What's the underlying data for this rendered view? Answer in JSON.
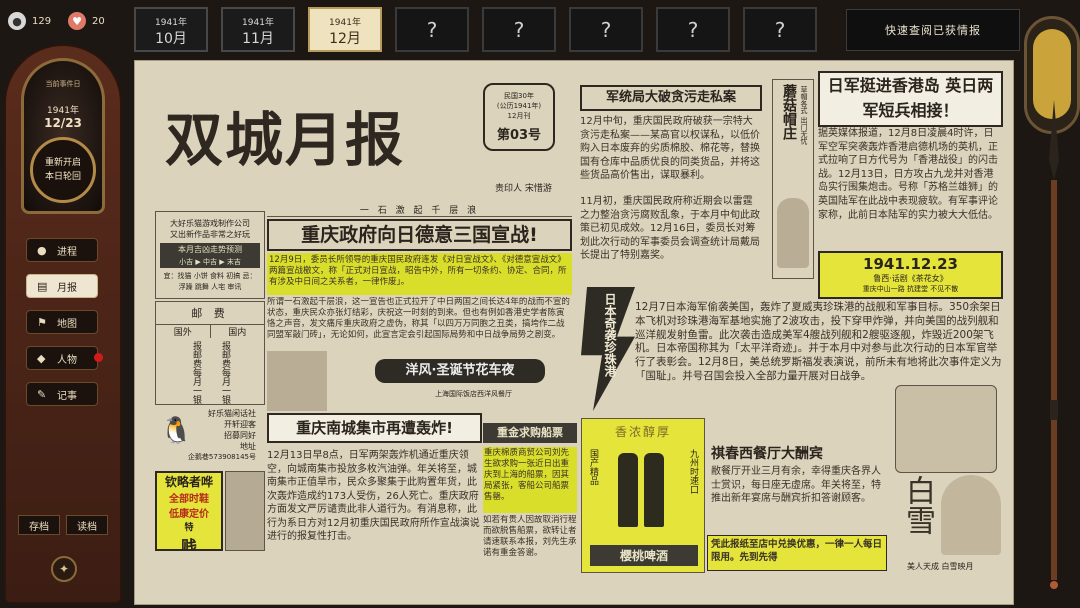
{
  "stats": {
    "coins": "129",
    "hearts": "20"
  },
  "clock": {
    "small": "当前事件日",
    "year": "1941年",
    "date": "12/23",
    "line1": "重新开启",
    "line2": "本日轮回"
  },
  "nav": [
    {
      "label": "进程",
      "icon": "●"
    },
    {
      "label": "月报",
      "icon": "▤"
    },
    {
      "label": "地图",
      "icon": "⚑"
    },
    {
      "label": "人物",
      "icon": "◆"
    },
    {
      "label": "记事",
      "icon": "✎"
    }
  ],
  "save": "存档",
  "load": "读档",
  "tabs": [
    {
      "y": "1941年",
      "m": "10月"
    },
    {
      "y": "1941年",
      "m": "11月"
    },
    {
      "y": "1941年",
      "m": "12月"
    }
  ],
  "locked_tab": "?",
  "quick": "快速查阅已获情报",
  "paper": {
    "masthead": "双城月报",
    "issue": {
      "l1": "民国30年",
      "l2": "(公历1941年)",
      "l3": "12月刊",
      "no": "第03号"
    },
    "printer": "责印人  宋惜游",
    "proverb": "一 石 激 起 千 层 浪",
    "h_war": "重庆政府向日德意三国宣战!",
    "war_hl": "12月9日，委员长所领导的重庆国民政府连发《对日宣战文》、《对德意宣战文》两篇宣战檄文，称「正式对日宣战，昭告中外，所有一切条约、协定、合同，所有涉及中日间之关系者，一律作废」。",
    "war_body": "所谓一石激起千层浪，这一宣告也正式拉开了中日两国之间长达4年的战而不宣的状态，重庆民众亦张灯结彩，庆祝这一时刻的到来。但也有例如香港史学者陈寅恪之声音，发文痛斥重庆政府之虚伪，称其「以四万万同胞之丑类，搞垮作二战同盟军敲门砖」，无论如何，此宣言定会引起国际局势和中日战争局势之剧变。",
    "h_bazaar": "洋风·圣诞节花车夜",
    "bazaar_sub": "上海国际饭店西洋风餐厅",
    "ad_left": {
      "l1": "大好乐猫游戏制作公司",
      "l2": "又出新作品非常之好玩",
      "bar1": "本月吉凶走势预测",
      "bar2": "小吉 ▶ 中吉 ▶ 末吉",
      "grid": "宜：找猫 小饼 食料 初搞  忌：浮躁 跳舞 人宅 审讯"
    },
    "postal": {
      "title": "邮 费",
      "c1": "国外",
      "c2": "国内",
      "rows": "报邮费每月一银元"
    },
    "cat_ad": {
      "l1": "好乐猫闲话社",
      "l2": "开轩迎客",
      "l3": "招募同好",
      "l4": "地址",
      "l5": "企鹅巷573908145号"
    },
    "h_bomb": "重庆南城集市再遭轰炸!",
    "bomb_body": "12月13日早8点，日军两架轰炸机通近重庆领空，向城南集市投放多枚汽油弹。年关将至，城南集市正值旱市，民众多聚集于此购置年货，此次轰炸造成约173人受伤，26人死亡。重庆政府方面发文严厉谴责此非人道行为。有消息称，此行为系日方对12月初重庆国民政府所作宣战演说进行的报复性打击。",
    "h_pest": "军统局大破贪污走私案",
    "pest_body": "12月中旬，重庆国民政府破获一宗特大贪污走私案——某高官以权谋私，以低价购入日本废弃的劣质棉胶、棉花等，替换国有仓库中品质优良的同类货品，并将这些货品高价售出，谋取暴利。",
    "pest_body2": "11月初，重庆国民政府称近期会以雷霆之力整治贪污腐败乱象，于本月中旬此政策已初见成效。12月16日，委员长对筹划此次行动的军事委员会调查统计局戴局长提出了特别嘉奖。",
    "hat": {
      "title": "蘑菇帽庄",
      "sub": "草帽各式 出门无忧"
    },
    "h_hk": "日军挺进香港岛 英日两军短兵相接！",
    "hk_body": "据英媒体报道，12月8日凌晨4时许，日军空军突袭轰炸香港启德机场的英机，正式拉响了日方代号为「香港战役」的闪击战。12月13日，日方攻占九龙并对香港岛实行围集炮击。号称「苏格兰雄狮」的英国陆军在此战中表现疲软。有军事评论家称，此前日本陆军的实力被大大低估。",
    "stamp": {
      "date": "1941.12.23",
      "l1": "鲁西·话剧《茶花女》",
      "l2": "重庆中山一路 抗建堂  不见不散"
    },
    "vertical": "日本奇袭珍珠港",
    "pearl_body": "12月7日本海军偷袭美国，轰炸了夏威夷珍珠港的战舰和军事目标。350余架日本飞机对珍珠港海军基地实施了2波攻击，投下穿甲炸弹，并向美国的战列舰和巡洋舰发射鱼雷。此次袭击造成美军4艘战列舰和2艘驱逐舰，炸毁近200架飞机。日本帝国称其为「太平洋奇迹」。并于本月中对参与此次行动的日本军官举行了表彰会。12月8日，美总统罗斯福发表演说，前所未有地将此次事件定义为「国耻」。并号召国会投入全部力量开展对日战争。",
    "ad_red": {
      "l1": "钦略者哗",
      "l2": "全部时鞋",
      "l3": "低康定价",
      "tag": "特",
      "price": "贱"
    },
    "h_gold": "重金求购船票",
    "gold_hl": "重庆棉质商贸公司刘先生欲求购一张近日出重庆到上海的船票，因其局紧张，客船公司船票售罄。",
    "gold_body": "如若有贵人因故取消行程而欲脱售船票，欲转让者请速联系本报，刘先生承诺有重金答谢。",
    "beer": {
      "l1": "香浓醇厚",
      "l2": "樱桃啤酒",
      "side1": "国产精品",
      "side2": "九州时速口"
    },
    "h_rest": "祺春西餐厅大酬宾",
    "rest_body": "敝餐厅开业三月有余，幸得重庆各界人士赏识，每日座无虚席。年关将至，特推出新年宴席与酬宾折扣答谢顾客。",
    "bottom_hl": "凭此报纸至店中兑换优惠，一律一人每日限用。先到先得",
    "beauty": {
      "big": "白雪",
      "sub": "美人天成  白雪映月"
    }
  }
}
